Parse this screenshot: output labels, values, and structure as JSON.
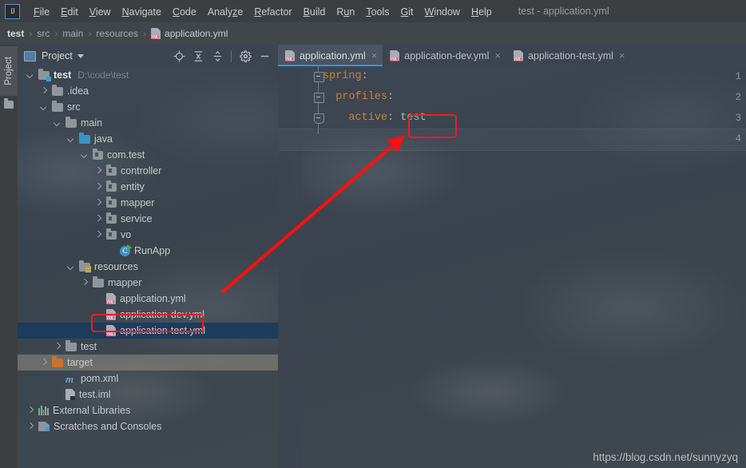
{
  "window": {
    "title": "test - application.yml",
    "logo_text": "IJ"
  },
  "menubar": {
    "items": [
      {
        "label": "File",
        "mnemonic": "F"
      },
      {
        "label": "Edit",
        "mnemonic": "E"
      },
      {
        "label": "View",
        "mnemonic": "V"
      },
      {
        "label": "Navigate",
        "mnemonic": "N"
      },
      {
        "label": "Code",
        "mnemonic": "C"
      },
      {
        "label": "Analyze",
        "mnemonic": "z"
      },
      {
        "label": "Refactor",
        "mnemonic": "R"
      },
      {
        "label": "Build",
        "mnemonic": "B"
      },
      {
        "label": "Run",
        "mnemonic": "u"
      },
      {
        "label": "Tools",
        "mnemonic": "T"
      },
      {
        "label": "Git",
        "mnemonic": "G"
      },
      {
        "label": "Window",
        "mnemonic": "W"
      },
      {
        "label": "Help",
        "mnemonic": "H"
      }
    ]
  },
  "breadcrumb": {
    "separator": "›",
    "items": [
      "test",
      "src",
      "main",
      "resources"
    ],
    "file": "application.yml",
    "file_icon": "yml-file-icon"
  },
  "toolstrip": {
    "project_tab_label": "Project",
    "folder_icon": "folder-icon"
  },
  "project_panel": {
    "title": "Project",
    "title_icon": "project-view-icon",
    "dropdown_icon": "chevron-down-icon",
    "tools": [
      {
        "name": "locate-icon",
        "label": "Select Opened File"
      },
      {
        "name": "expand-all-icon",
        "label": "Expand All"
      },
      {
        "name": "collapse-all-icon",
        "label": "Collapse All"
      },
      {
        "name": "gear-icon",
        "label": "Settings"
      },
      {
        "name": "minimize-icon",
        "label": "Hide"
      }
    ],
    "tree": [
      {
        "label": "test",
        "path": "D:\\code\\test",
        "indent": 0,
        "arrow": "down",
        "icon": "module-folder-icon",
        "bold": true
      },
      {
        "label": ".idea",
        "indent": 1,
        "arrow": "right",
        "icon": "folder-icon"
      },
      {
        "label": "src",
        "indent": 1,
        "arrow": "down",
        "icon": "folder-icon"
      },
      {
        "label": "main",
        "indent": 2,
        "arrow": "down",
        "icon": "folder-icon"
      },
      {
        "label": "java",
        "indent": 3,
        "arrow": "down",
        "icon": "source-folder-icon"
      },
      {
        "label": "com.test",
        "indent": 4,
        "arrow": "down",
        "icon": "package-icon"
      },
      {
        "label": "controller",
        "indent": 5,
        "arrow": "right",
        "icon": "package-icon"
      },
      {
        "label": "entity",
        "indent": 5,
        "arrow": "right",
        "icon": "package-icon"
      },
      {
        "label": "mapper",
        "indent": 5,
        "arrow": "right",
        "icon": "package-icon"
      },
      {
        "label": "service",
        "indent": 5,
        "arrow": "right",
        "icon": "package-icon"
      },
      {
        "label": "vo",
        "indent": 5,
        "arrow": "right",
        "icon": "package-icon"
      },
      {
        "label": "RunApp",
        "indent": 6,
        "arrow": "none",
        "icon": "runnable-class-icon"
      },
      {
        "label": "resources",
        "indent": 3,
        "arrow": "down",
        "icon": "resources-folder-icon"
      },
      {
        "label": "mapper",
        "indent": 4,
        "arrow": "right",
        "icon": "folder-icon"
      },
      {
        "label": "application.yml",
        "indent": 5,
        "arrow": "none",
        "icon": "yml-file-icon",
        "highlighted": true
      },
      {
        "label": "application-dev.yml",
        "indent": 5,
        "arrow": "none",
        "icon": "yml-file-icon"
      },
      {
        "label": "application-test.yml",
        "indent": 5,
        "arrow": "none",
        "icon": "yml-file-icon",
        "selected": true
      },
      {
        "label": "test",
        "indent": 2,
        "arrow": "right",
        "icon": "folder-icon"
      },
      {
        "label": "target",
        "indent": 1,
        "arrow": "right",
        "icon": "target-folder-icon",
        "hover": true
      },
      {
        "label": "pom.xml",
        "indent": 2,
        "arrow": "none",
        "icon": "maven-icon"
      },
      {
        "label": "test.iml",
        "indent": 2,
        "arrow": "none",
        "icon": "iml-file-icon"
      },
      {
        "label": "External Libraries",
        "indent": 0,
        "arrow": "right",
        "icon": "external-libraries-icon"
      },
      {
        "label": "Scratches and Consoles",
        "indent": 0,
        "arrow": "right",
        "icon": "scratches-icon"
      }
    ]
  },
  "editor": {
    "tabs": [
      {
        "label": "application.yml",
        "icon": "yml-file-icon",
        "active": true,
        "close_icon": "close-icon"
      },
      {
        "label": "application-dev.yml",
        "icon": "yml-file-icon",
        "active": false,
        "close_icon": "close-icon"
      },
      {
        "label": "application-test.yml",
        "icon": "yml-file-icon",
        "active": false,
        "close_icon": "close-icon"
      }
    ],
    "line_numbers": [
      "1",
      "2",
      "3",
      "4"
    ],
    "lines": [
      {
        "indent": "",
        "key": "spring",
        "colon": ":",
        "value": ""
      },
      {
        "indent": "  ",
        "key": "profiles",
        "colon": ":",
        "value": ""
      },
      {
        "indent": "    ",
        "key": "active",
        "colon": ":",
        "value": " test"
      }
    ],
    "highlighted_value": "test",
    "current_line": "4"
  },
  "annotations": {
    "box_color": "#f01c1c",
    "arrow_color": "#ff0f0f"
  },
  "watermark": {
    "text": "https://blog.csdn.net/sunnyzyq"
  }
}
